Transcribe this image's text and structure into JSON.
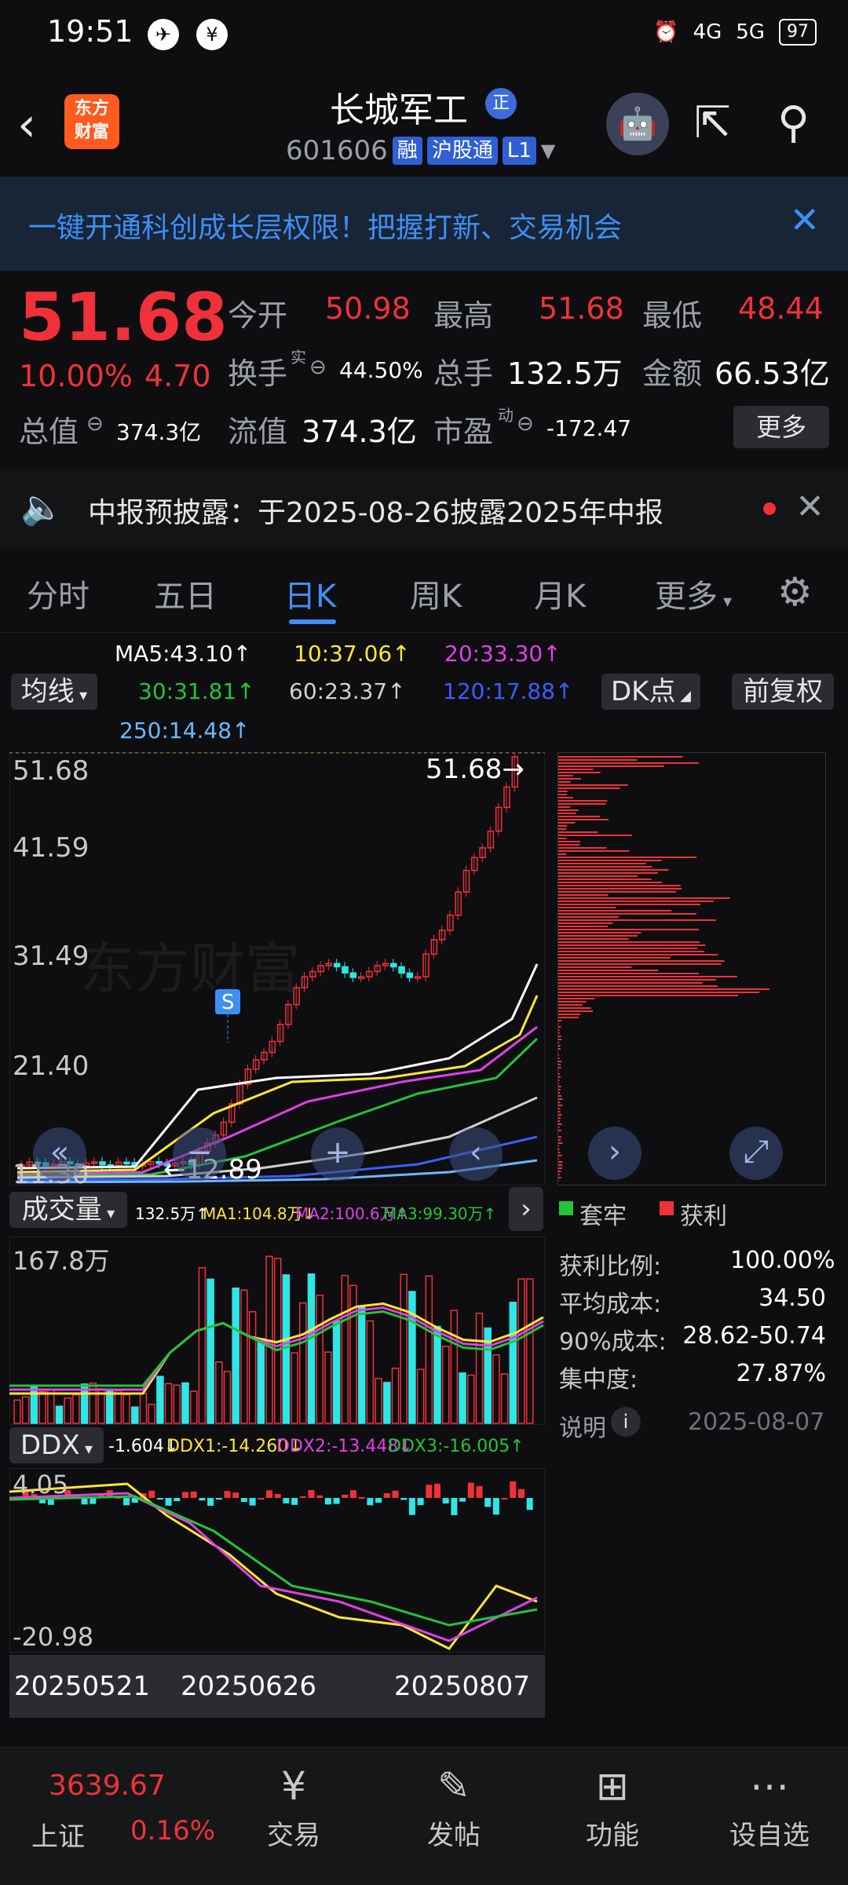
{
  "status": {
    "time": "19:51",
    "net1": "4G",
    "net2": "5G",
    "battery": "97"
  },
  "header": {
    "logo": "东方\n财富",
    "name": "长城军工",
    "badge": "正",
    "code": "601606",
    "tags": [
      "融",
      "沪股通",
      "L1"
    ]
  },
  "banner": {
    "text": "一键开通科创成长层权限！把握打新、交易机会"
  },
  "quote": {
    "price": "51.68",
    "pct": "10.00%",
    "chg": "4.70",
    "open_label": "今开",
    "open": "50.98",
    "high_label": "最高",
    "high": "51.68",
    "low_label": "最低",
    "low": "48.44",
    "turnover_label": "换手",
    "turnover_sup": "实",
    "turnover": "44.50%",
    "vol_label": "总手",
    "vol": "132.5万",
    "amt_label": "金额",
    "amt": "66.53亿",
    "mcap_label": "总值",
    "mcap": "374.3亿",
    "float_label": "流值",
    "float": "374.3亿",
    "pe_label": "市盈",
    "pe_sup": "动",
    "pe": "-172.47",
    "more": "更多"
  },
  "notice": {
    "text": "中报预披露：于2025-08-26披露2025年中报"
  },
  "tabs": [
    "分时",
    "五日",
    "日K",
    "周K",
    "月K",
    "更多"
  ],
  "ma": {
    "ma5": "MA5:43.10↑",
    "ma10": "10:37.06↑",
    "ma20": "20:33.30↑",
    "ma30": "30:31.81↑",
    "ma60": "60:23.37↑",
    "ma120": "120:17.88↑",
    "ma250": "250:14.48↑",
    "indicator": "均线",
    "dk": "DK点",
    "adj": "前复权",
    "colors": {
      "ma5": "#ffffff",
      "ma10": "#ffe733",
      "ma20": "#e040e8",
      "ma30": "#22c43a",
      "ma60": "#d0d0d0",
      "ma120": "#3d5cff",
      "ma250": "#6ab8ff"
    }
  },
  "kchart": {
    "y_labels": [
      "51.68",
      "41.59",
      "31.49",
      "21.40",
      "11.30"
    ],
    "last_label": "51.68→",
    "low_label": "←12.89",
    "s_marker": "S"
  },
  "volume": {
    "title": "成交量",
    "v": "132.5万↑",
    "ma1": "MA1:104.8万↓",
    "ma2": "MA2:100.6万↑",
    "ma3": "MA3:99.30万↑",
    "y_max": "167.8万"
  },
  "ddx": {
    "title": "DDX",
    "v": "-1.604↓",
    "d1": "DDX1:-14.260↓",
    "d2": "DDX2:-13.448↓",
    "d3": "DDX3:-16.005↑",
    "y_top": "4.05",
    "y_bot": "-20.98"
  },
  "dates": [
    "20250521",
    "20250626",
    "20250807"
  ],
  "profile": {
    "legend_trap": "套牢",
    "legend_profit": "获利",
    "rows": [
      {
        "k": "获利比例:",
        "v": "100.00%"
      },
      {
        "k": "平均成本:",
        "v": "34.50"
      },
      {
        "k": "90%成本:",
        "v": "28.62-50.74"
      },
      {
        "k": "集中度:",
        "v": "27.87%"
      }
    ],
    "note": "说明",
    "date": "2025-08-07"
  },
  "bottom": {
    "index_value": "3639.67",
    "index_name": "上证",
    "index_pct": "0.16%",
    "items": [
      "交易",
      "发帖",
      "功能",
      "设自选"
    ]
  }
}
